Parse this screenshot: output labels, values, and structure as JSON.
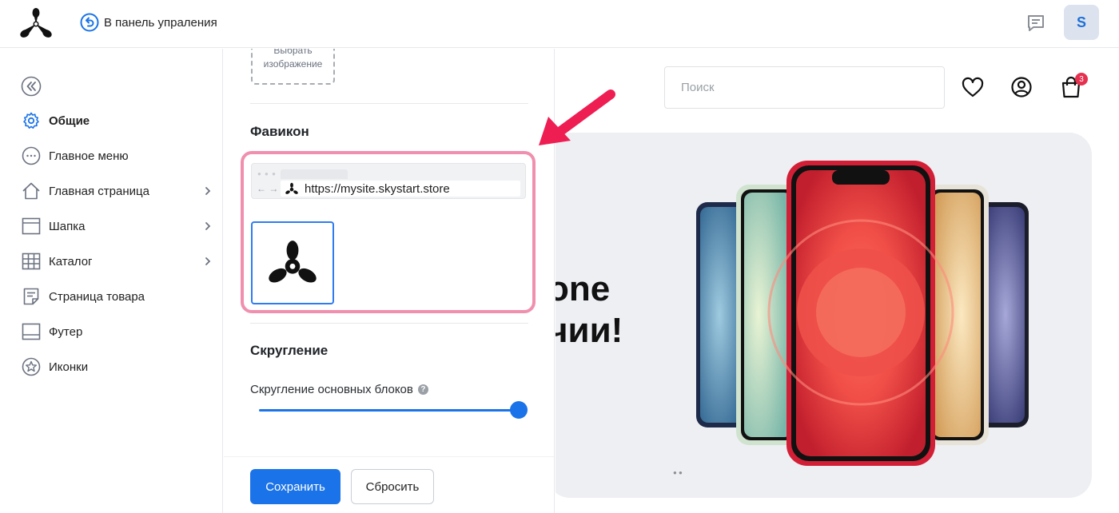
{
  "header": {
    "back_label": "В панель упраления",
    "avatar_letter": "S"
  },
  "sidebar": {
    "items": [
      {
        "label": "Общие",
        "icon": "gear-icon",
        "active": true,
        "chevron": false
      },
      {
        "label": "Главное меню",
        "icon": "dots-circle-icon",
        "active": false,
        "chevron": false
      },
      {
        "label": "Главная страница",
        "icon": "home-icon",
        "active": false,
        "chevron": true
      },
      {
        "label": "Шапка",
        "icon": "header-layout-icon",
        "active": false,
        "chevron": true
      },
      {
        "label": "Каталог",
        "icon": "grid-icon",
        "active": false,
        "chevron": true
      },
      {
        "label": "Страница товара",
        "icon": "document-icon",
        "active": false,
        "chevron": false
      },
      {
        "label": "Футер",
        "icon": "footer-layout-icon",
        "active": false,
        "chevron": false
      },
      {
        "label": "Иконки",
        "icon": "star-circle-icon",
        "active": false,
        "chevron": false
      }
    ]
  },
  "panel": {
    "image_picker_label": "Выбрать изображение",
    "favicon_title": "Фавикон",
    "favicon_url": "https://mysite.skystart.store",
    "rounding_title": "Скругление",
    "rounding_label": "Скругление основных блоков",
    "rounding_help": "?",
    "rounding_value": 1.0,
    "save_label": "Сохранить",
    "reset_label": "Сбросить"
  },
  "preview": {
    "search_placeholder": "Поиск",
    "cart_count": "3",
    "banner_line1": "one",
    "banner_line2": "чии!"
  },
  "colors": {
    "accent": "#1a73e8",
    "highlight": "#f08fae",
    "arrow": "#ee1d52",
    "badge": "#e5304f"
  }
}
